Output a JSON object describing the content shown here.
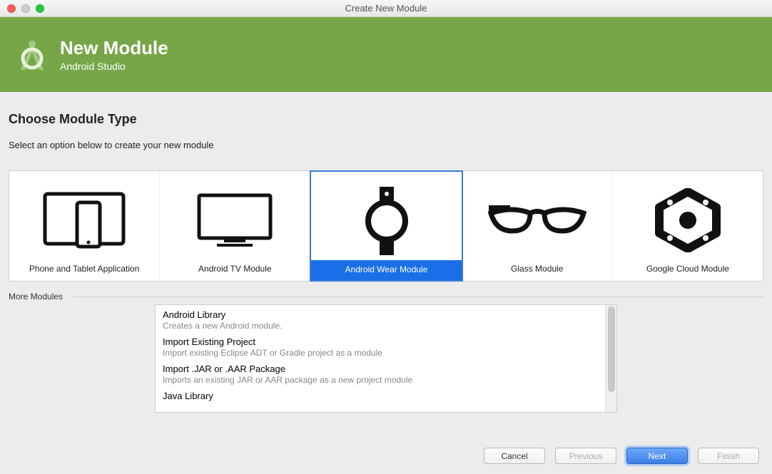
{
  "window": {
    "title": "Create New Module"
  },
  "header": {
    "title": "New Module",
    "subtitle": "Android Studio"
  },
  "page": {
    "section_title": "Choose Module Type",
    "instruction": "Select an option below to create your new module",
    "more_label": "More Modules"
  },
  "cards": [
    {
      "label": "Phone and Tablet Application"
    },
    {
      "label": "Android TV Module"
    },
    {
      "label": "Android Wear Module",
      "selected": true
    },
    {
      "label": "Glass Module"
    },
    {
      "label": "Google Cloud Module"
    }
  ],
  "more_modules": [
    {
      "title": "Android Library",
      "desc": "Creates a new Android module."
    },
    {
      "title": "Import Existing Project",
      "desc": "Import existing Eclipse ADT or Gradle project as a module"
    },
    {
      "title": "Import .JAR or .AAR Package",
      "desc": "Imports an existing JAR or AAR package as a new project module"
    },
    {
      "title": "Java Library",
      "desc": ""
    }
  ],
  "buttons": {
    "cancel": "Cancel",
    "previous": "Previous",
    "next": "Next",
    "finish": "Finish"
  }
}
